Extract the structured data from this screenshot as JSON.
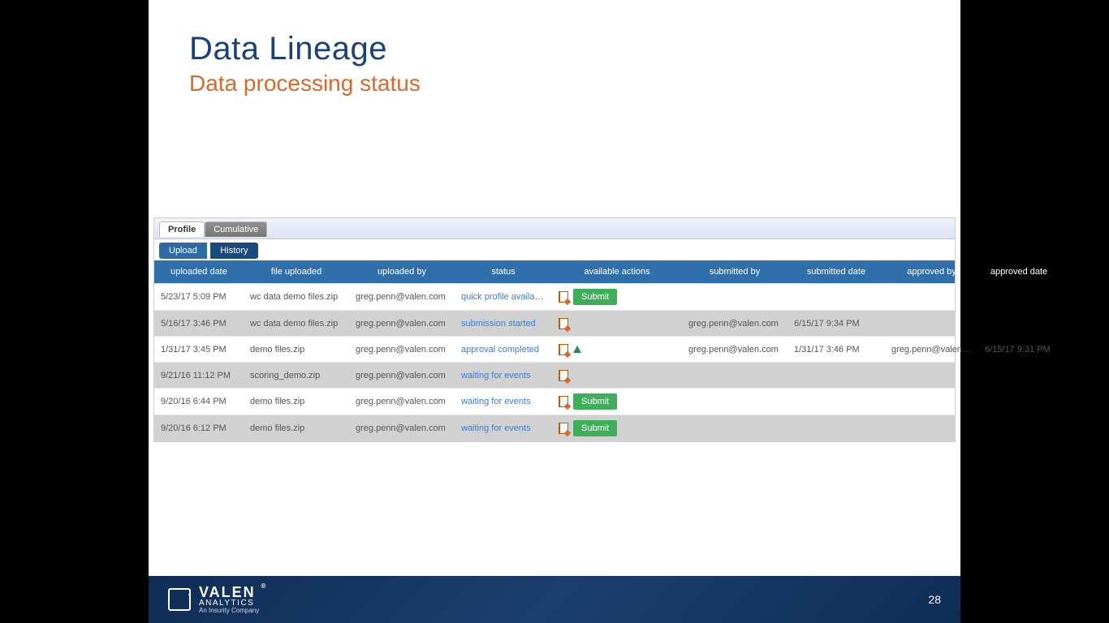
{
  "slide": {
    "title": "Data Lineage",
    "subtitle": "Data processing status",
    "page_number": "28"
  },
  "footer": {
    "brand": "VALEN",
    "reg": "®",
    "line1": "ANALYTICS",
    "line2": "An Insurity Company"
  },
  "app": {
    "top_tabs": {
      "profile": "Profile",
      "cumulative": "Cumulative"
    },
    "sub_tabs": {
      "upload": "Upload",
      "history": "History"
    },
    "columns": {
      "uploaded_date": "uploaded date",
      "file_uploaded": "file uploaded",
      "uploaded_by": "uploaded by",
      "status": "status",
      "available_actions": "available actions",
      "submitted_by": "submitted by",
      "submitted_date": "submitted date",
      "approved_by": "approved by",
      "approved_date": "approved date"
    },
    "submit_label": "Submit",
    "rows": [
      {
        "uploaded_date": "5/23/17 5:09 PM",
        "file_uploaded": "wc data demo files.zip",
        "uploaded_by": "greg.penn@valen.com",
        "status": "quick profile available",
        "has_edit": true,
        "has_submit": true,
        "has_approve": false,
        "submitted_by": "",
        "submitted_date": "",
        "approved_by": "",
        "approved_date": ""
      },
      {
        "uploaded_date": "5/16/17 3:46 PM",
        "file_uploaded": "wc data demo files.zip",
        "uploaded_by": "greg.penn@valen.com",
        "status": "submission started",
        "has_edit": true,
        "has_submit": false,
        "has_approve": false,
        "submitted_by": "greg.penn@valen.com",
        "submitted_date": "6/15/17 9:34 PM",
        "approved_by": "",
        "approved_date": ""
      },
      {
        "uploaded_date": "1/31/17 3:45 PM",
        "file_uploaded": "demo files.zip",
        "uploaded_by": "greg.penn@valen.com",
        "status": "approval completed",
        "has_edit": true,
        "has_submit": false,
        "has_approve": true,
        "submitted_by": "greg.penn@valen.com",
        "submitted_date": "1/31/17 3:46 PM",
        "approved_by": "greg.penn@valen.com",
        "approved_date": "6/15/17 9:31 PM"
      },
      {
        "uploaded_date": "9/21/16 11:12 PM",
        "file_uploaded": "scoring_demo.zip",
        "uploaded_by": "greg.penn@valen.com",
        "status": "waiting for events",
        "has_edit": true,
        "has_submit": false,
        "has_approve": false,
        "submitted_by": "",
        "submitted_date": "",
        "approved_by": "",
        "approved_date": ""
      },
      {
        "uploaded_date": "9/20/16 6:44 PM",
        "file_uploaded": "demo files.zip",
        "uploaded_by": "greg.penn@valen.com",
        "status": "waiting for events",
        "has_edit": true,
        "has_submit": true,
        "has_approve": false,
        "submitted_by": "",
        "submitted_date": "",
        "approved_by": "",
        "approved_date": ""
      },
      {
        "uploaded_date": "9/20/16 6:12 PM",
        "file_uploaded": "demo files.zip",
        "uploaded_by": "greg.penn@valen.com",
        "status": "waiting for events",
        "has_edit": true,
        "has_submit": true,
        "has_approve": false,
        "submitted_by": "",
        "submitted_date": "",
        "approved_by": "",
        "approved_date": ""
      }
    ]
  }
}
